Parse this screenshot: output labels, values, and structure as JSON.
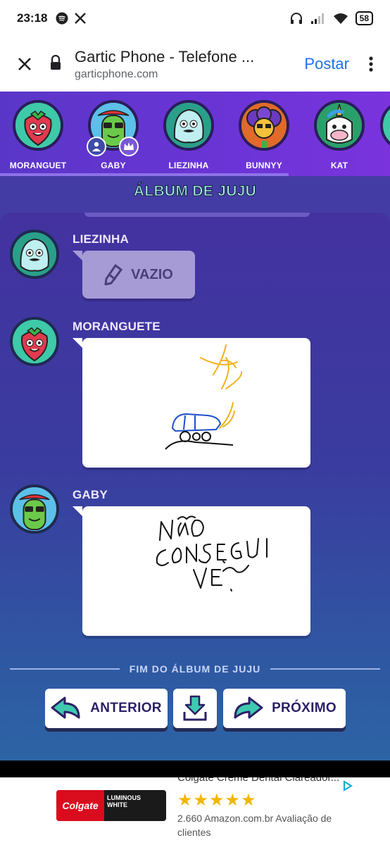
{
  "status_bar": {
    "time": "23:18",
    "battery": "58"
  },
  "browser": {
    "title": "Gartic Phone - Telefone ...",
    "url": "garticphone.com",
    "post_label": "Postar"
  },
  "players": [
    {
      "name": "MORANGUET"
    },
    {
      "name": "GABY"
    },
    {
      "name": "LIEZINHA"
    },
    {
      "name": "BUNNYY"
    },
    {
      "name": "KAT"
    }
  ],
  "album": {
    "title": "ÁLBUM DE JUJU",
    "entries": [
      {
        "name": "LIEZINHA",
        "empty_label": "VAZIO"
      },
      {
        "name": "MORANGUETE"
      },
      {
        "name": "GABY"
      }
    ],
    "end_label": "FIM DO ÁLBUM DE JUJU"
  },
  "buttons": {
    "previous": "ANTERIOR",
    "next": "PRÓXIMO"
  },
  "ad": {
    "logo": "Colgate",
    "product_line1": "LUMINOUS",
    "product_line2": "WHITE",
    "title": "Colgate Creme Dental Clareador...",
    "stars": "★★★★★",
    "meta": "2.660 Amazon.com.br Avaliação de clientes"
  },
  "colors": {
    "accent_title": "#a7f0ee",
    "link_blue": "#1a73e8",
    "purple_header": "#6b34d6"
  }
}
